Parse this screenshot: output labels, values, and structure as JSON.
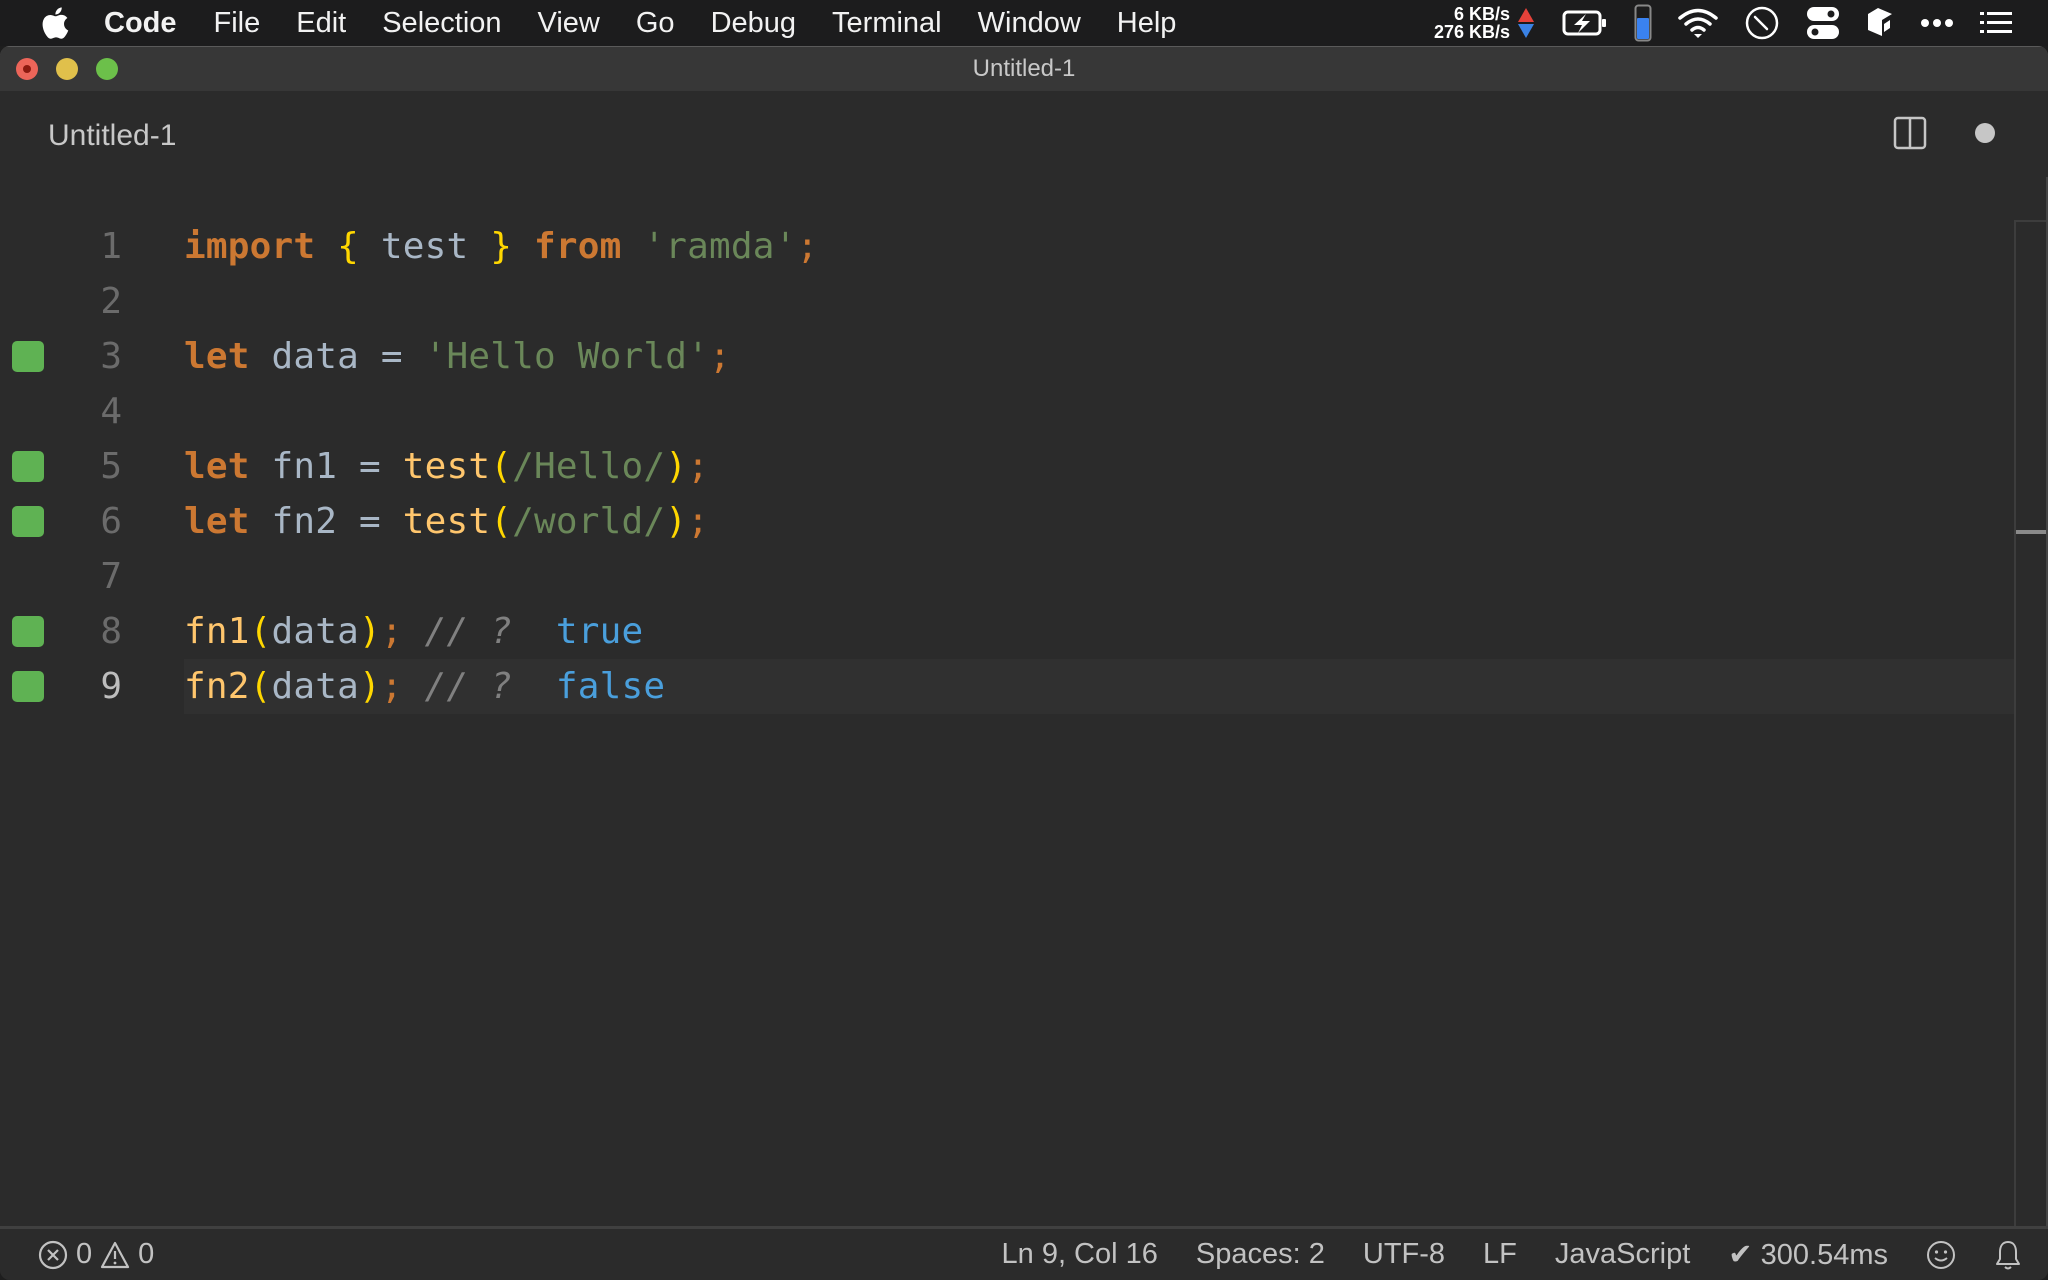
{
  "menubar": {
    "app_name": "Code",
    "items": [
      "File",
      "Edit",
      "Selection",
      "View",
      "Go",
      "Debug",
      "Terminal",
      "Window",
      "Help"
    ],
    "status": {
      "upload_speed": "6 KB/s",
      "download_speed": "276 KB/s",
      "icons": [
        "battery-charging-icon",
        "memory-gauge-icon",
        "wifi-icon",
        "clock-icon",
        "toggle-icon",
        "app-cube-icon",
        "more-icon",
        "list-icon"
      ]
    }
  },
  "window": {
    "title": "Untitled-1"
  },
  "tab": {
    "label": "Untitled-1",
    "unsaved": true
  },
  "editor": {
    "current_line": 9,
    "lines": [
      {
        "number": "1",
        "marker": false,
        "tokens": [
          {
            "t": "import",
            "c": "kw"
          },
          {
            "t": " ",
            "c": "id"
          },
          {
            "t": "{",
            "c": "br"
          },
          {
            "t": " test ",
            "c": "id"
          },
          {
            "t": "}",
            "c": "br"
          },
          {
            "t": " ",
            "c": "id"
          },
          {
            "t": "from",
            "c": "kw"
          },
          {
            "t": " ",
            "c": "id"
          },
          {
            "t": "'ramda'",
            "c": "str"
          },
          {
            "t": ";",
            "c": "punc"
          }
        ]
      },
      {
        "number": "2",
        "marker": false,
        "tokens": []
      },
      {
        "number": "3",
        "marker": true,
        "tokens": [
          {
            "t": "let",
            "c": "kw"
          },
          {
            "t": " data ",
            "c": "id"
          },
          {
            "t": "=",
            "c": "op"
          },
          {
            "t": " ",
            "c": "id"
          },
          {
            "t": "'Hello World'",
            "c": "str"
          },
          {
            "t": ";",
            "c": "punc"
          }
        ]
      },
      {
        "number": "4",
        "marker": false,
        "tokens": []
      },
      {
        "number": "5",
        "marker": true,
        "tokens": [
          {
            "t": "let",
            "c": "kw"
          },
          {
            "t": " fn1 ",
            "c": "id"
          },
          {
            "t": "=",
            "c": "op"
          },
          {
            "t": " ",
            "c": "id"
          },
          {
            "t": "test",
            "c": "fn"
          },
          {
            "t": "(",
            "c": "br"
          },
          {
            "t": "/Hello/",
            "c": "str"
          },
          {
            "t": ")",
            "c": "br"
          },
          {
            "t": ";",
            "c": "punc"
          }
        ]
      },
      {
        "number": "6",
        "marker": true,
        "tokens": [
          {
            "t": "let",
            "c": "kw"
          },
          {
            "t": " fn2 ",
            "c": "id"
          },
          {
            "t": "=",
            "c": "op"
          },
          {
            "t": " ",
            "c": "id"
          },
          {
            "t": "test",
            "c": "fn"
          },
          {
            "t": "(",
            "c": "br"
          },
          {
            "t": "/world/",
            "c": "str"
          },
          {
            "t": ")",
            "c": "br"
          },
          {
            "t": ";",
            "c": "punc"
          }
        ]
      },
      {
        "number": "7",
        "marker": false,
        "tokens": []
      },
      {
        "number": "8",
        "marker": true,
        "tokens": [
          {
            "t": "fn1",
            "c": "fn"
          },
          {
            "t": "(",
            "c": "br"
          },
          {
            "t": "data",
            "c": "id"
          },
          {
            "t": ")",
            "c": "br"
          },
          {
            "t": ";",
            "c": "punc"
          },
          {
            "t": " ",
            "c": "id"
          },
          {
            "t": "// ?",
            "c": "cmt"
          },
          {
            "t": "  ",
            "c": "id"
          },
          {
            "t": "true",
            "c": "res"
          }
        ]
      },
      {
        "number": "9",
        "marker": true,
        "tokens": [
          {
            "t": "fn2",
            "c": "fn"
          },
          {
            "t": "(",
            "c": "br"
          },
          {
            "t": "data",
            "c": "id"
          },
          {
            "t": ")",
            "c": "br"
          },
          {
            "t": ";",
            "c": "punc"
          },
          {
            "t": " ",
            "c": "id"
          },
          {
            "t": "// ?",
            "c": "cmt"
          },
          {
            "t": "  ",
            "c": "id"
          },
          {
            "t": "false",
            "c": "res"
          }
        ]
      }
    ]
  },
  "statusbar": {
    "errors": "0",
    "warnings": "0",
    "cursor": "Ln 9, Col 16",
    "indent": "Spaces: 2",
    "encoding": "UTF-8",
    "eol": "LF",
    "language": "JavaScript",
    "timing": "✔ 300.54ms"
  },
  "colors": {
    "coverage_marker": "#5fb253",
    "keyword": "#cc7832",
    "string": "#6a8759",
    "function": "#ffc66d",
    "bracket": "#ffd700",
    "result": "#4a9fdc"
  }
}
